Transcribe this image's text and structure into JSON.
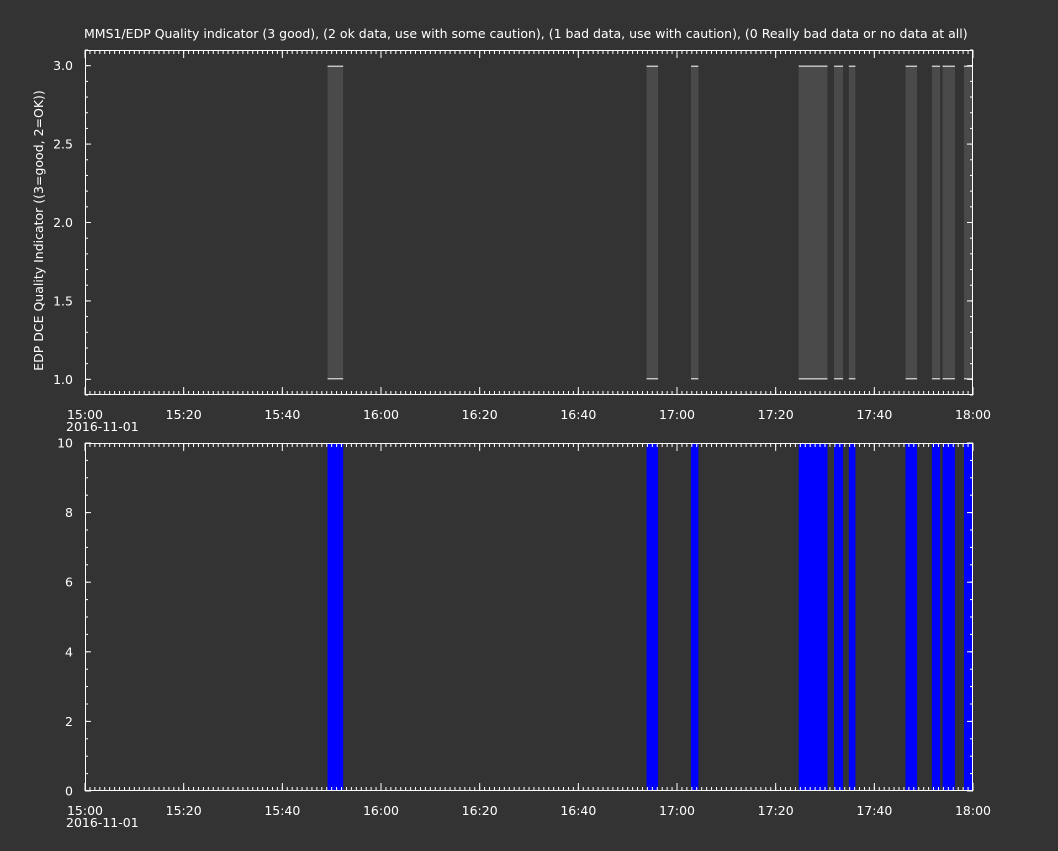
{
  "chart_data": [
    {
      "type": "bar",
      "title": "MMS1/EDP  Quality indicator (3 good), (2 ok data, use with some caution), (1 bad data, use with caution), (0 Really bad data or no data at all)",
      "xlabel": "",
      "ylabel": "EDP DCE Quality Indicator ((3=good, 2=OK))",
      "date_label": "2016-11-01",
      "xlim": [
        "15:00",
        "18:00"
      ],
      "xticks": [
        "15:00",
        "15:20",
        "15:40",
        "16:00",
        "16:20",
        "16:40",
        "17:00",
        "17:20",
        "17:40",
        "18:00"
      ],
      "ylim": [
        0.9,
        3.1
      ],
      "yticks": [
        "1.0",
        "1.5",
        "2.0",
        "2.5",
        "3.0"
      ],
      "grid": false,
      "bar_color": "#4a4a4a",
      "series": [
        {
          "intervals": [
            {
              "start": "15:49:10",
              "end": "15:52:20",
              "low": 1.0,
              "high": 3.0
            },
            {
              "start": "16:53:50",
              "end": "16:56:10",
              "low": 1.0,
              "high": 3.0
            },
            {
              "start": "17:02:50",
              "end": "17:04:20",
              "low": 1.0,
              "high": 3.0
            },
            {
              "start": "17:24:40",
              "end": "17:30:30",
              "low": 1.0,
              "high": 3.0
            },
            {
              "start": "17:31:50",
              "end": "17:33:40",
              "low": 1.0,
              "high": 3.0
            },
            {
              "start": "17:34:50",
              "end": "17:36:10",
              "low": 1.0,
              "high": 3.0
            },
            {
              "start": "17:46:20",
              "end": "17:48:40",
              "low": 1.0,
              "high": 3.0
            },
            {
              "start": "17:51:40",
              "end": "17:53:20",
              "low": 1.0,
              "high": 3.0
            },
            {
              "start": "17:53:50",
              "end": "17:56:20",
              "low": 1.0,
              "high": 3.0
            },
            {
              "start": "17:58:10",
              "end": "17:59:50",
              "low": 1.0,
              "high": 3.0
            }
          ]
        }
      ]
    },
    {
      "type": "bar",
      "title": "",
      "xlabel": "",
      "ylabel": "",
      "date_label": "2016-11-01",
      "xlim": [
        "15:00",
        "18:00"
      ],
      "xticks": [
        "15:00",
        "15:20",
        "15:40",
        "16:00",
        "16:20",
        "16:40",
        "17:00",
        "17:20",
        "17:40",
        "18:00"
      ],
      "ylim": [
        0,
        10
      ],
      "yticks": [
        "0",
        "2",
        "4",
        "6",
        "8",
        "10"
      ],
      "grid": false,
      "bar_color": "#0000ff",
      "series": [
        {
          "intervals": [
            {
              "start": "15:49:10",
              "end": "15:52:20",
              "low": 0,
              "high": 10
            },
            {
              "start": "16:53:50",
              "end": "16:56:10",
              "low": 0,
              "high": 10
            },
            {
              "start": "17:02:50",
              "end": "17:04:20",
              "low": 0,
              "high": 10
            },
            {
              "start": "17:24:40",
              "end": "17:30:30",
              "low": 0,
              "high": 10
            },
            {
              "start": "17:31:50",
              "end": "17:33:40",
              "low": 0,
              "high": 10
            },
            {
              "start": "17:34:50",
              "end": "17:36:10",
              "low": 0,
              "high": 10
            },
            {
              "start": "17:46:20",
              "end": "17:48:40",
              "low": 0,
              "high": 10
            },
            {
              "start": "17:51:40",
              "end": "17:53:20",
              "low": 0,
              "high": 10
            },
            {
              "start": "17:53:50",
              "end": "17:56:20",
              "low": 0,
              "high": 10
            },
            {
              "start": "17:58:10",
              "end": "17:59:50",
              "low": 0,
              "high": 10
            }
          ]
        }
      ]
    }
  ]
}
